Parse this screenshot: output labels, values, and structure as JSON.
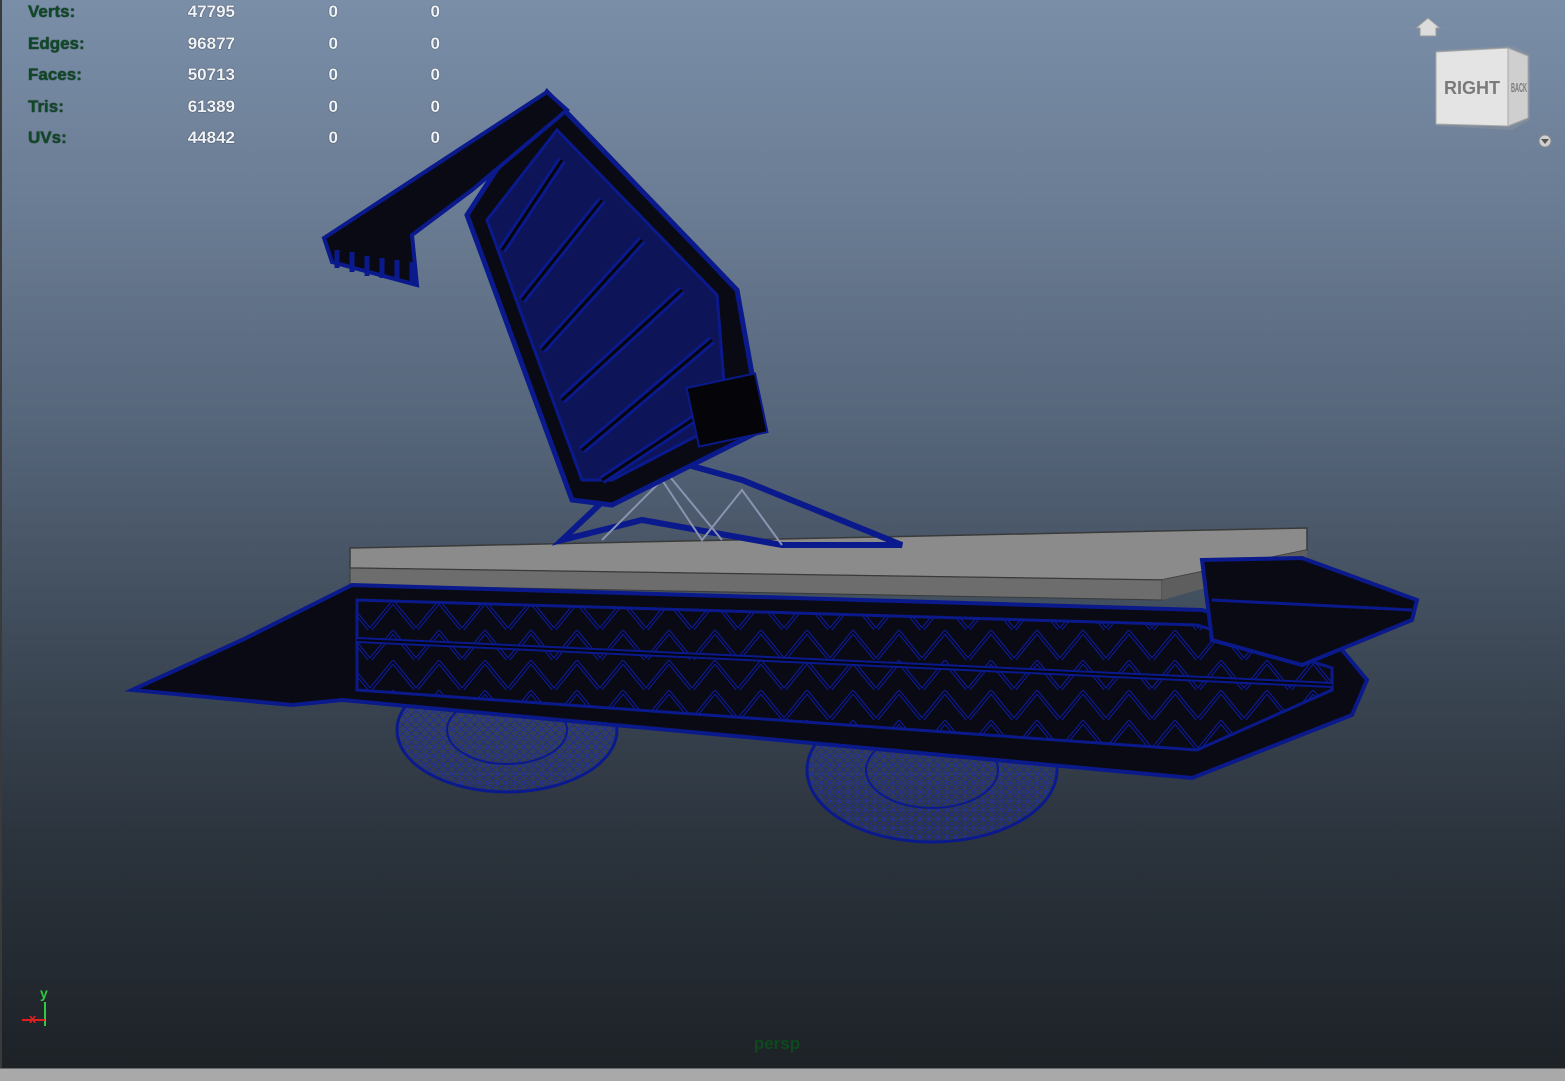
{
  "stats": [
    {
      "label": "Verts:",
      "v1": "47795",
      "v2": "0",
      "v3": "0"
    },
    {
      "label": "Edges:",
      "v1": "96877",
      "v2": "0",
      "v3": "0"
    },
    {
      "label": "Faces:",
      "v1": "50713",
      "v2": "0",
      "v3": "0"
    },
    {
      "label": "Tris:",
      "v1": "61389",
      "v2": "0",
      "v3": "0"
    },
    {
      "label": "UVs:",
      "v1": "44842",
      "v2": "0",
      "v3": "0"
    }
  ],
  "viewcube": {
    "face_front": "RIGHT",
    "face_side": "BACK"
  },
  "camera_label": "persp",
  "axis": {
    "y": "y",
    "x": "x"
  },
  "colors": {
    "wire": "#0a1a8c",
    "deck": "#8e8e8e",
    "dark": "#0b0b12"
  }
}
